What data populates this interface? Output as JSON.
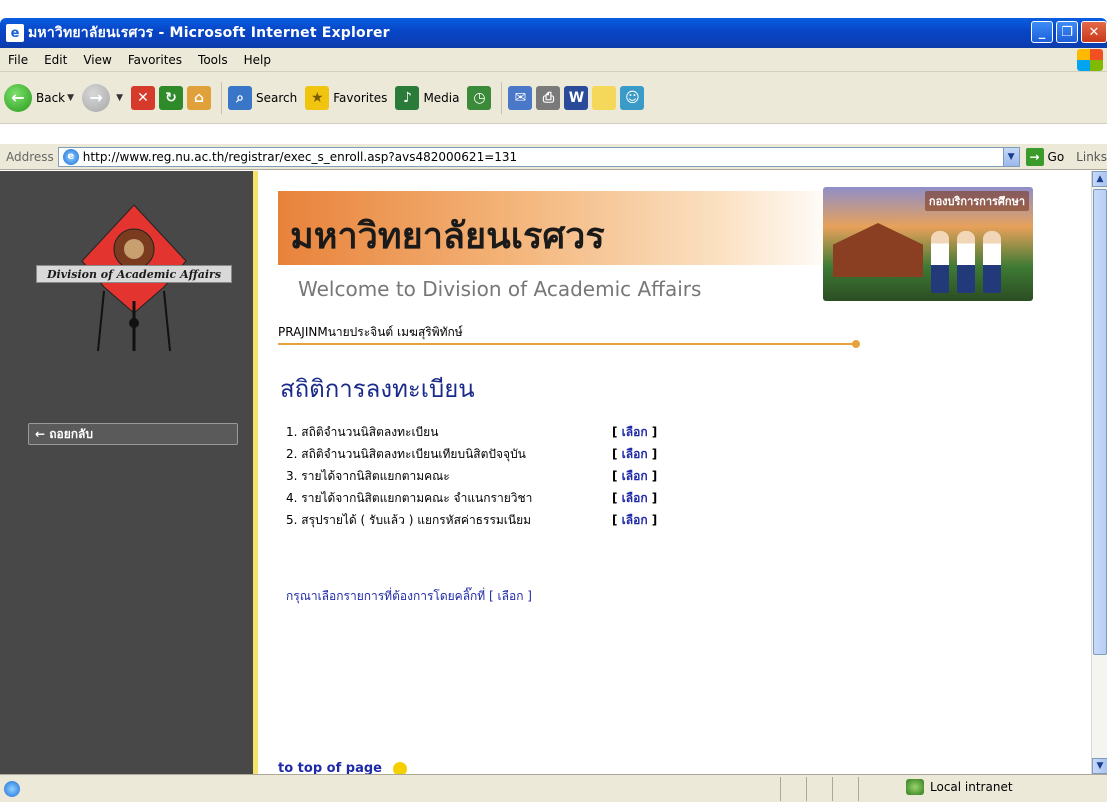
{
  "window": {
    "title": "มหาวิทยาลัยนเรศวร - Microsoft Internet Explorer"
  },
  "menu": [
    "File",
    "Edit",
    "View",
    "Favorites",
    "Tools",
    "Help"
  ],
  "toolbar": {
    "back_label": "Back",
    "search_label": "Search",
    "favorites_label": "Favorites",
    "media_label": "Media"
  },
  "address": {
    "label": "Address",
    "url": "http://www.reg.nu.ac.th/registrar/exec_s_enroll.asp?avs482000621=131",
    "go_label": "Go",
    "links_label": "Links"
  },
  "sidebar": {
    "logo_label": "Division of Academic Affairs",
    "back_button": "← ถอยกลับ"
  },
  "banner": {
    "title": "มหาวิทยาลัยนเรศวร",
    "subtitle": "Welcome to Division of Academic Affairs",
    "photo_caption": "กองบริการการศึกษา"
  },
  "user": {
    "text": "PRAJINMนายประจินต์ เมฆสุริพิทักษ์"
  },
  "heading": "สถิติการลงทะเบียน",
  "stats": [
    {
      "label": "1.  สถิติจำนวนนิสิตลงทะเบียน",
      "link": "เลือก"
    },
    {
      "label": "2.  สถิติจำนวนนิสิตลงทะเบียนเทียบนิสิตปัจจุบัน",
      "link": "เลือก"
    },
    {
      "label": "3.  รายได้จากนิสิตแยกตามคณะ",
      "link": "เลือก"
    },
    {
      "label": "4.  รายได้จากนิสิตแยกตามคณะ จำแนกรายวิชา",
      "link": "เลือก"
    },
    {
      "label": "5.  สรุปรายได้ ( รับแล้ว ) แยกรหัสค่าธรรมเนียม",
      "link": "เลือก"
    }
  ],
  "hint": "กรุณาเลือกรายการที่ต้องการโดยคลิ๊กที่ [ เลือก ]",
  "to_top": "to top of page",
  "status": {
    "zone": "Local intranet"
  }
}
